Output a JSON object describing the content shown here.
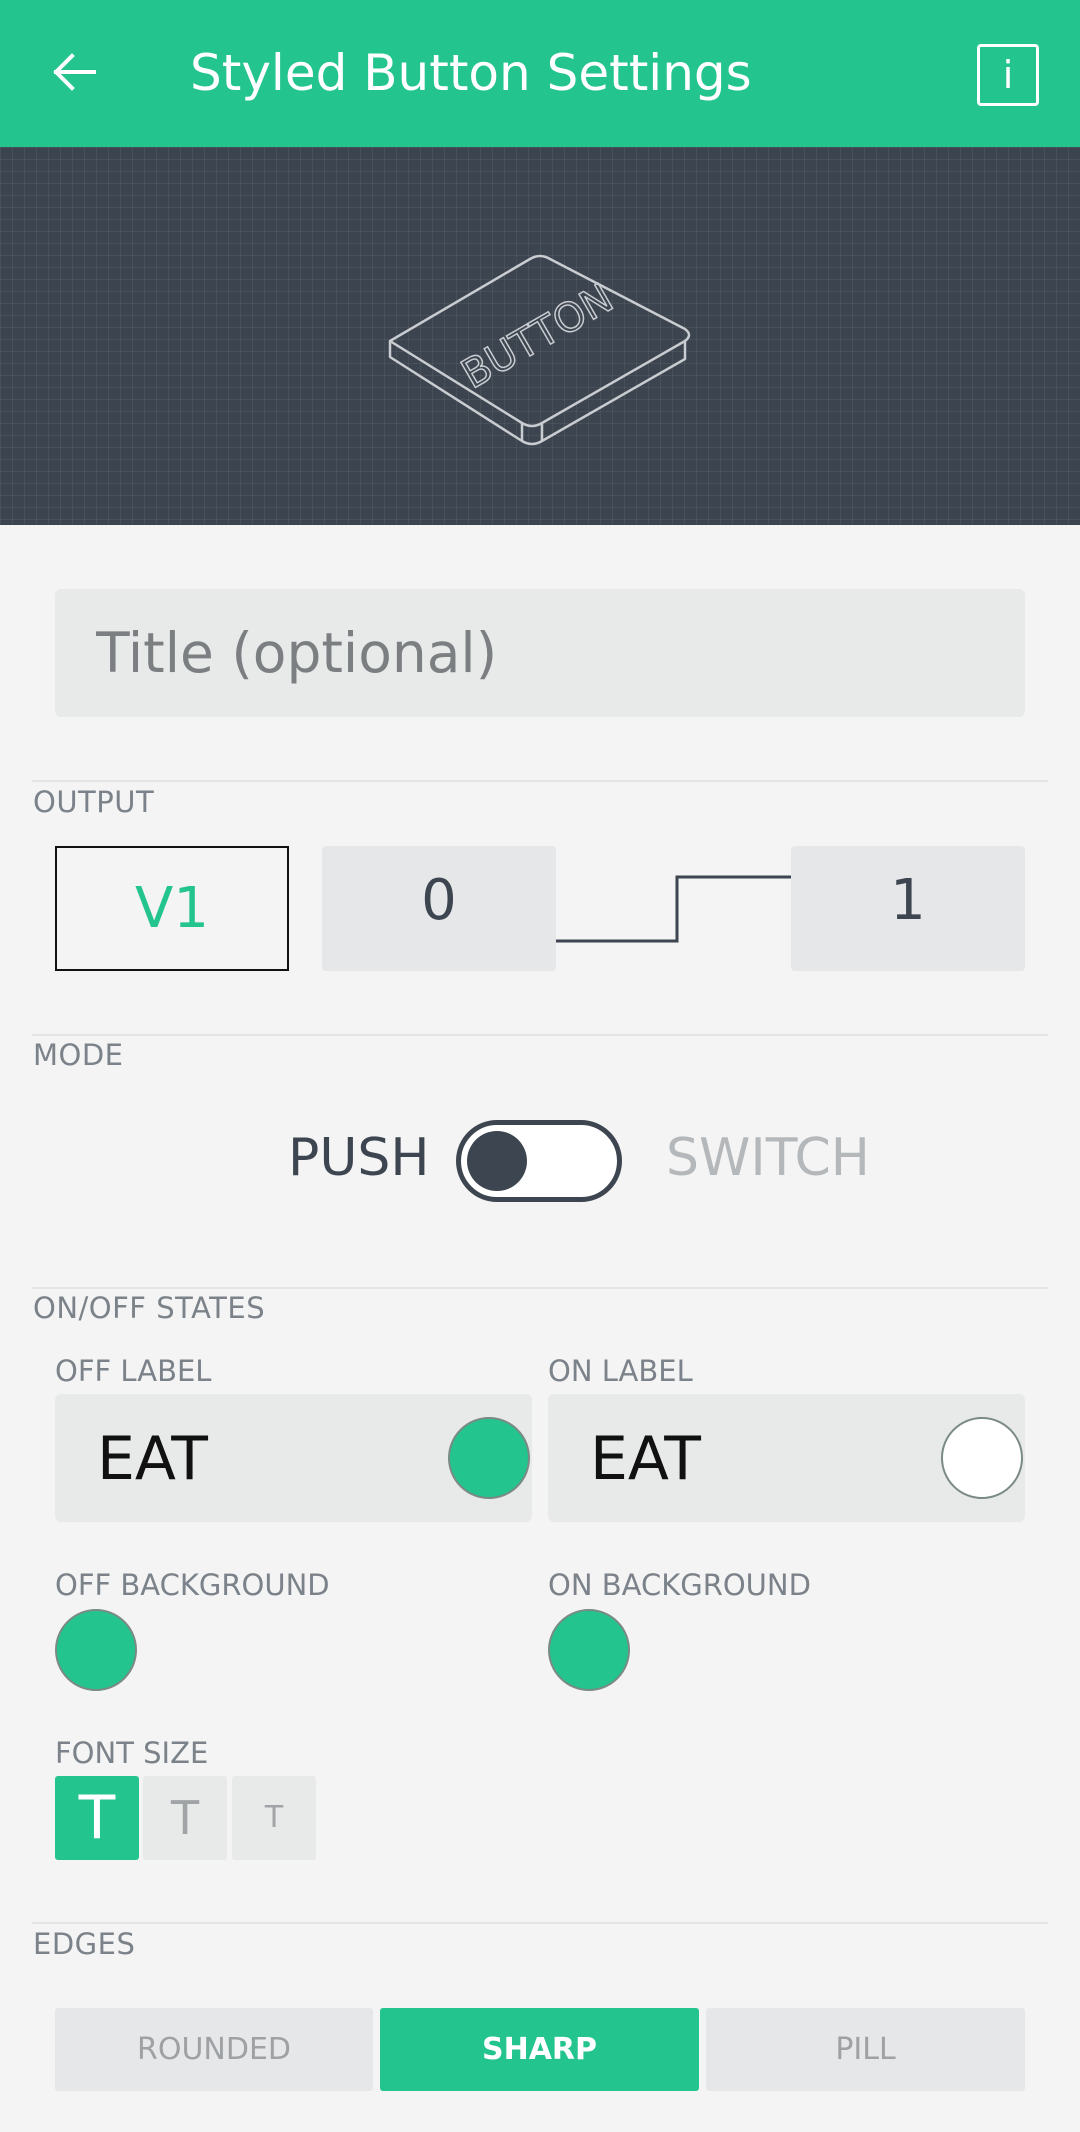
{
  "appbar": {
    "title": "Styled Button Settings",
    "info_label": "i"
  },
  "preview": {
    "button_text": "BUTTON"
  },
  "title_field": {
    "placeholder": "Title (optional)",
    "value": ""
  },
  "output": {
    "section_label": "OUTPUT",
    "pin": "V1",
    "low_value": "0",
    "high_value": "1"
  },
  "mode": {
    "section_label": "MODE",
    "push_label": "PUSH",
    "switch_label": "SWITCH",
    "selected": "PUSH"
  },
  "states": {
    "section_label": "ON/OFF STATES",
    "off_label_title": "OFF LABEL",
    "off_label_value": "EAT",
    "off_label_color": "#23c48e",
    "on_label_title": "ON LABEL",
    "on_label_value": "EAT",
    "on_label_color": "#ffffff",
    "off_background_title": "OFF BACKGROUND",
    "off_background_color": "#23c48e",
    "on_background_title": "ON BACKGROUND",
    "on_background_color": "#23c48e"
  },
  "font_size": {
    "title": "FONT SIZE",
    "options": [
      {
        "label": "T",
        "size": "large",
        "selected": true
      },
      {
        "label": "T",
        "size": "medium",
        "selected": false
      },
      {
        "label": "T",
        "size": "small",
        "selected": false
      }
    ]
  },
  "edges": {
    "section_label": "EDGES",
    "options": [
      "ROUNDED",
      "SHARP",
      "PILL"
    ],
    "selected": "SHARP"
  },
  "colors": {
    "accent": "#23c48e",
    "dark": "#3d4550"
  },
  "icons": {
    "back": "back-arrow-icon",
    "info": "info-icon"
  }
}
